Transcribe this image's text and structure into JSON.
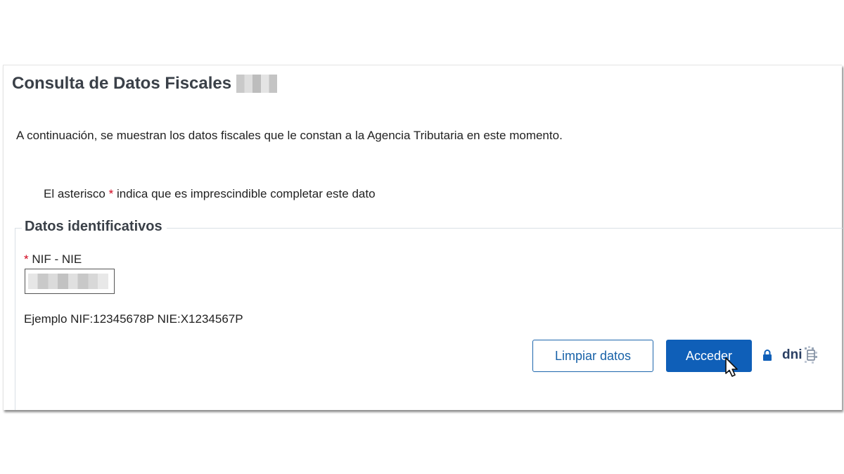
{
  "header": {
    "title": "Consulta de Datos Fiscales"
  },
  "intro_text": "A continuación, se muestran los datos fiscales que le constan a la Agencia Tributaria en este momento.",
  "required_note": {
    "prefix": "El asterisco ",
    "asterisk": "*",
    "suffix": " indica que es imprescindible completar este dato"
  },
  "section": {
    "legend": "Datos identificativos",
    "field": {
      "required_mark": "*",
      "label": " NIF - NIE",
      "value": ""
    },
    "example": "Ejemplo NIF:12345678P NIE:X1234567P"
  },
  "actions": {
    "clear_label": "Limpiar datos",
    "access_label": "Acceder"
  },
  "dni_logo_text": "dni",
  "icons": {
    "lock": "lock-icon",
    "cursor": "mouse-pointer-icon"
  },
  "colors": {
    "primary": "#0f5fb8",
    "outline_button": "#1d66ad",
    "required": "#d0021b",
    "heading": "#3a4048"
  }
}
